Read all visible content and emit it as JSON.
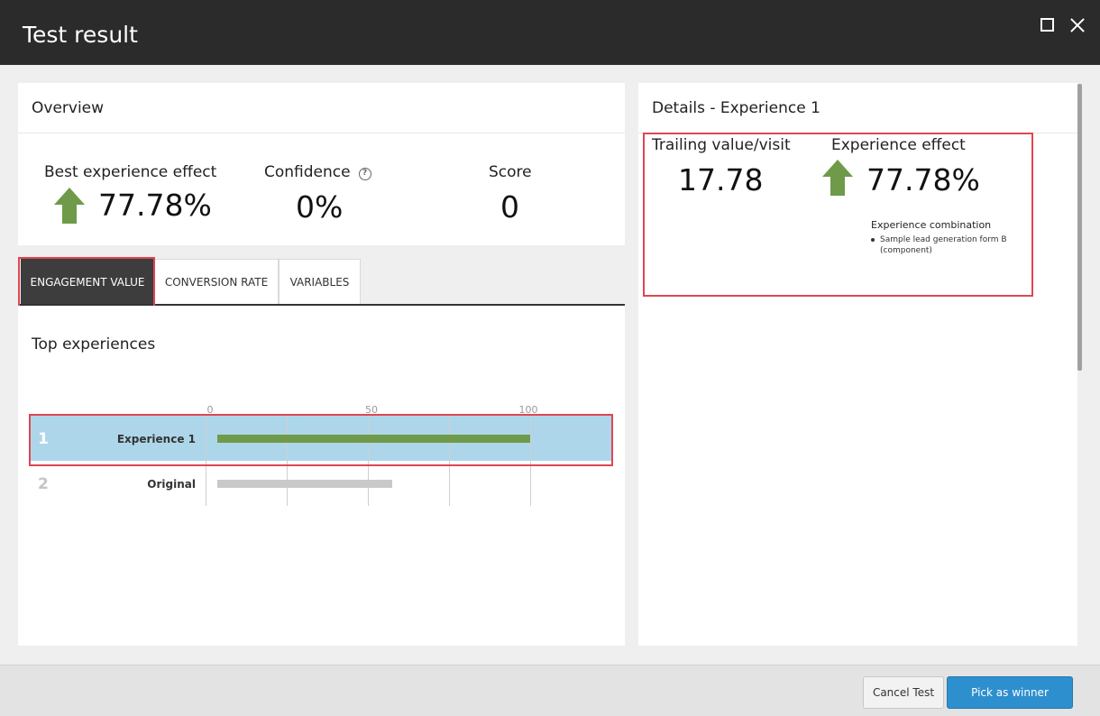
{
  "window": {
    "title": "Test result"
  },
  "overview": {
    "title": "Overview",
    "best_effect_label": "Best experience effect",
    "best_effect_value": "77.78%",
    "confidence_label": "Confidence",
    "confidence_value": "0%",
    "score_label": "Score",
    "score_value": "0"
  },
  "tabs": [
    {
      "label": "ENGAGEMENT VALUE",
      "active": true
    },
    {
      "label": "CONVERSION RATE",
      "active": false
    },
    {
      "label": "VARIABLES",
      "active": false
    }
  ],
  "top_experiences": {
    "title": "Top experiences",
    "axis_ticks": [
      "0",
      "50",
      "100"
    ],
    "axis_max": 100,
    "rows": [
      {
        "rank": "1",
        "label": "Experience 1",
        "value": 100,
        "color": "#6f9a4a",
        "selected": true
      },
      {
        "rank": "2",
        "label": "Original",
        "value": 56,
        "color": "#c9c9c9",
        "selected": false
      }
    ]
  },
  "details": {
    "title": "Details - Experience 1",
    "trailing_label": "Trailing value/visit",
    "trailing_value": "17.78",
    "effect_label": "Experience effect",
    "effect_value": "77.78%",
    "combination_title": "Experience combination",
    "combination_items": [
      "Sample lead generation form B (component)"
    ]
  },
  "footer": {
    "cancel_label": "Cancel Test",
    "winner_label": "Pick as winner"
  },
  "colors": {
    "accent": "#2e8fcf",
    "positive": "#6f9a4a",
    "highlight": "#e04652",
    "selected_row": "#add6ea"
  }
}
